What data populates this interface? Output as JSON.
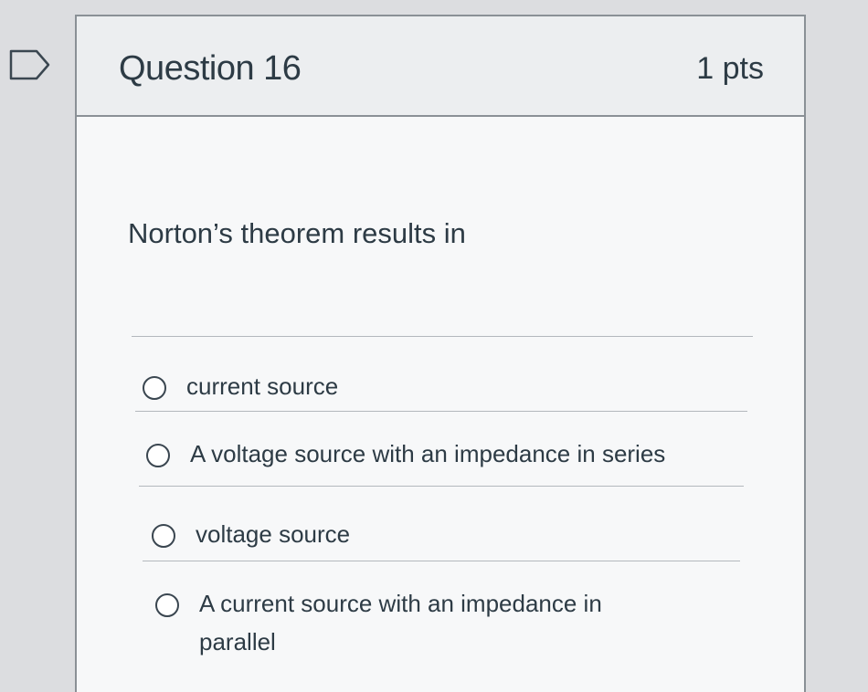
{
  "question": {
    "title": "Question 16",
    "points": "1 pts",
    "text": "Norton’s theorem results in"
  },
  "answers": [
    {
      "label": "current source"
    },
    {
      "label": "A voltage source with an impedance in series"
    },
    {
      "label": "voltage source"
    },
    {
      "label": "A current source with an impedance in parallel"
    }
  ],
  "icons": {
    "flag": "flag-icon"
  },
  "colors": {
    "text": "#2d3b45",
    "border": "#8a9096",
    "header_bg": "#eceef0",
    "divider": "#b3b8bd"
  }
}
